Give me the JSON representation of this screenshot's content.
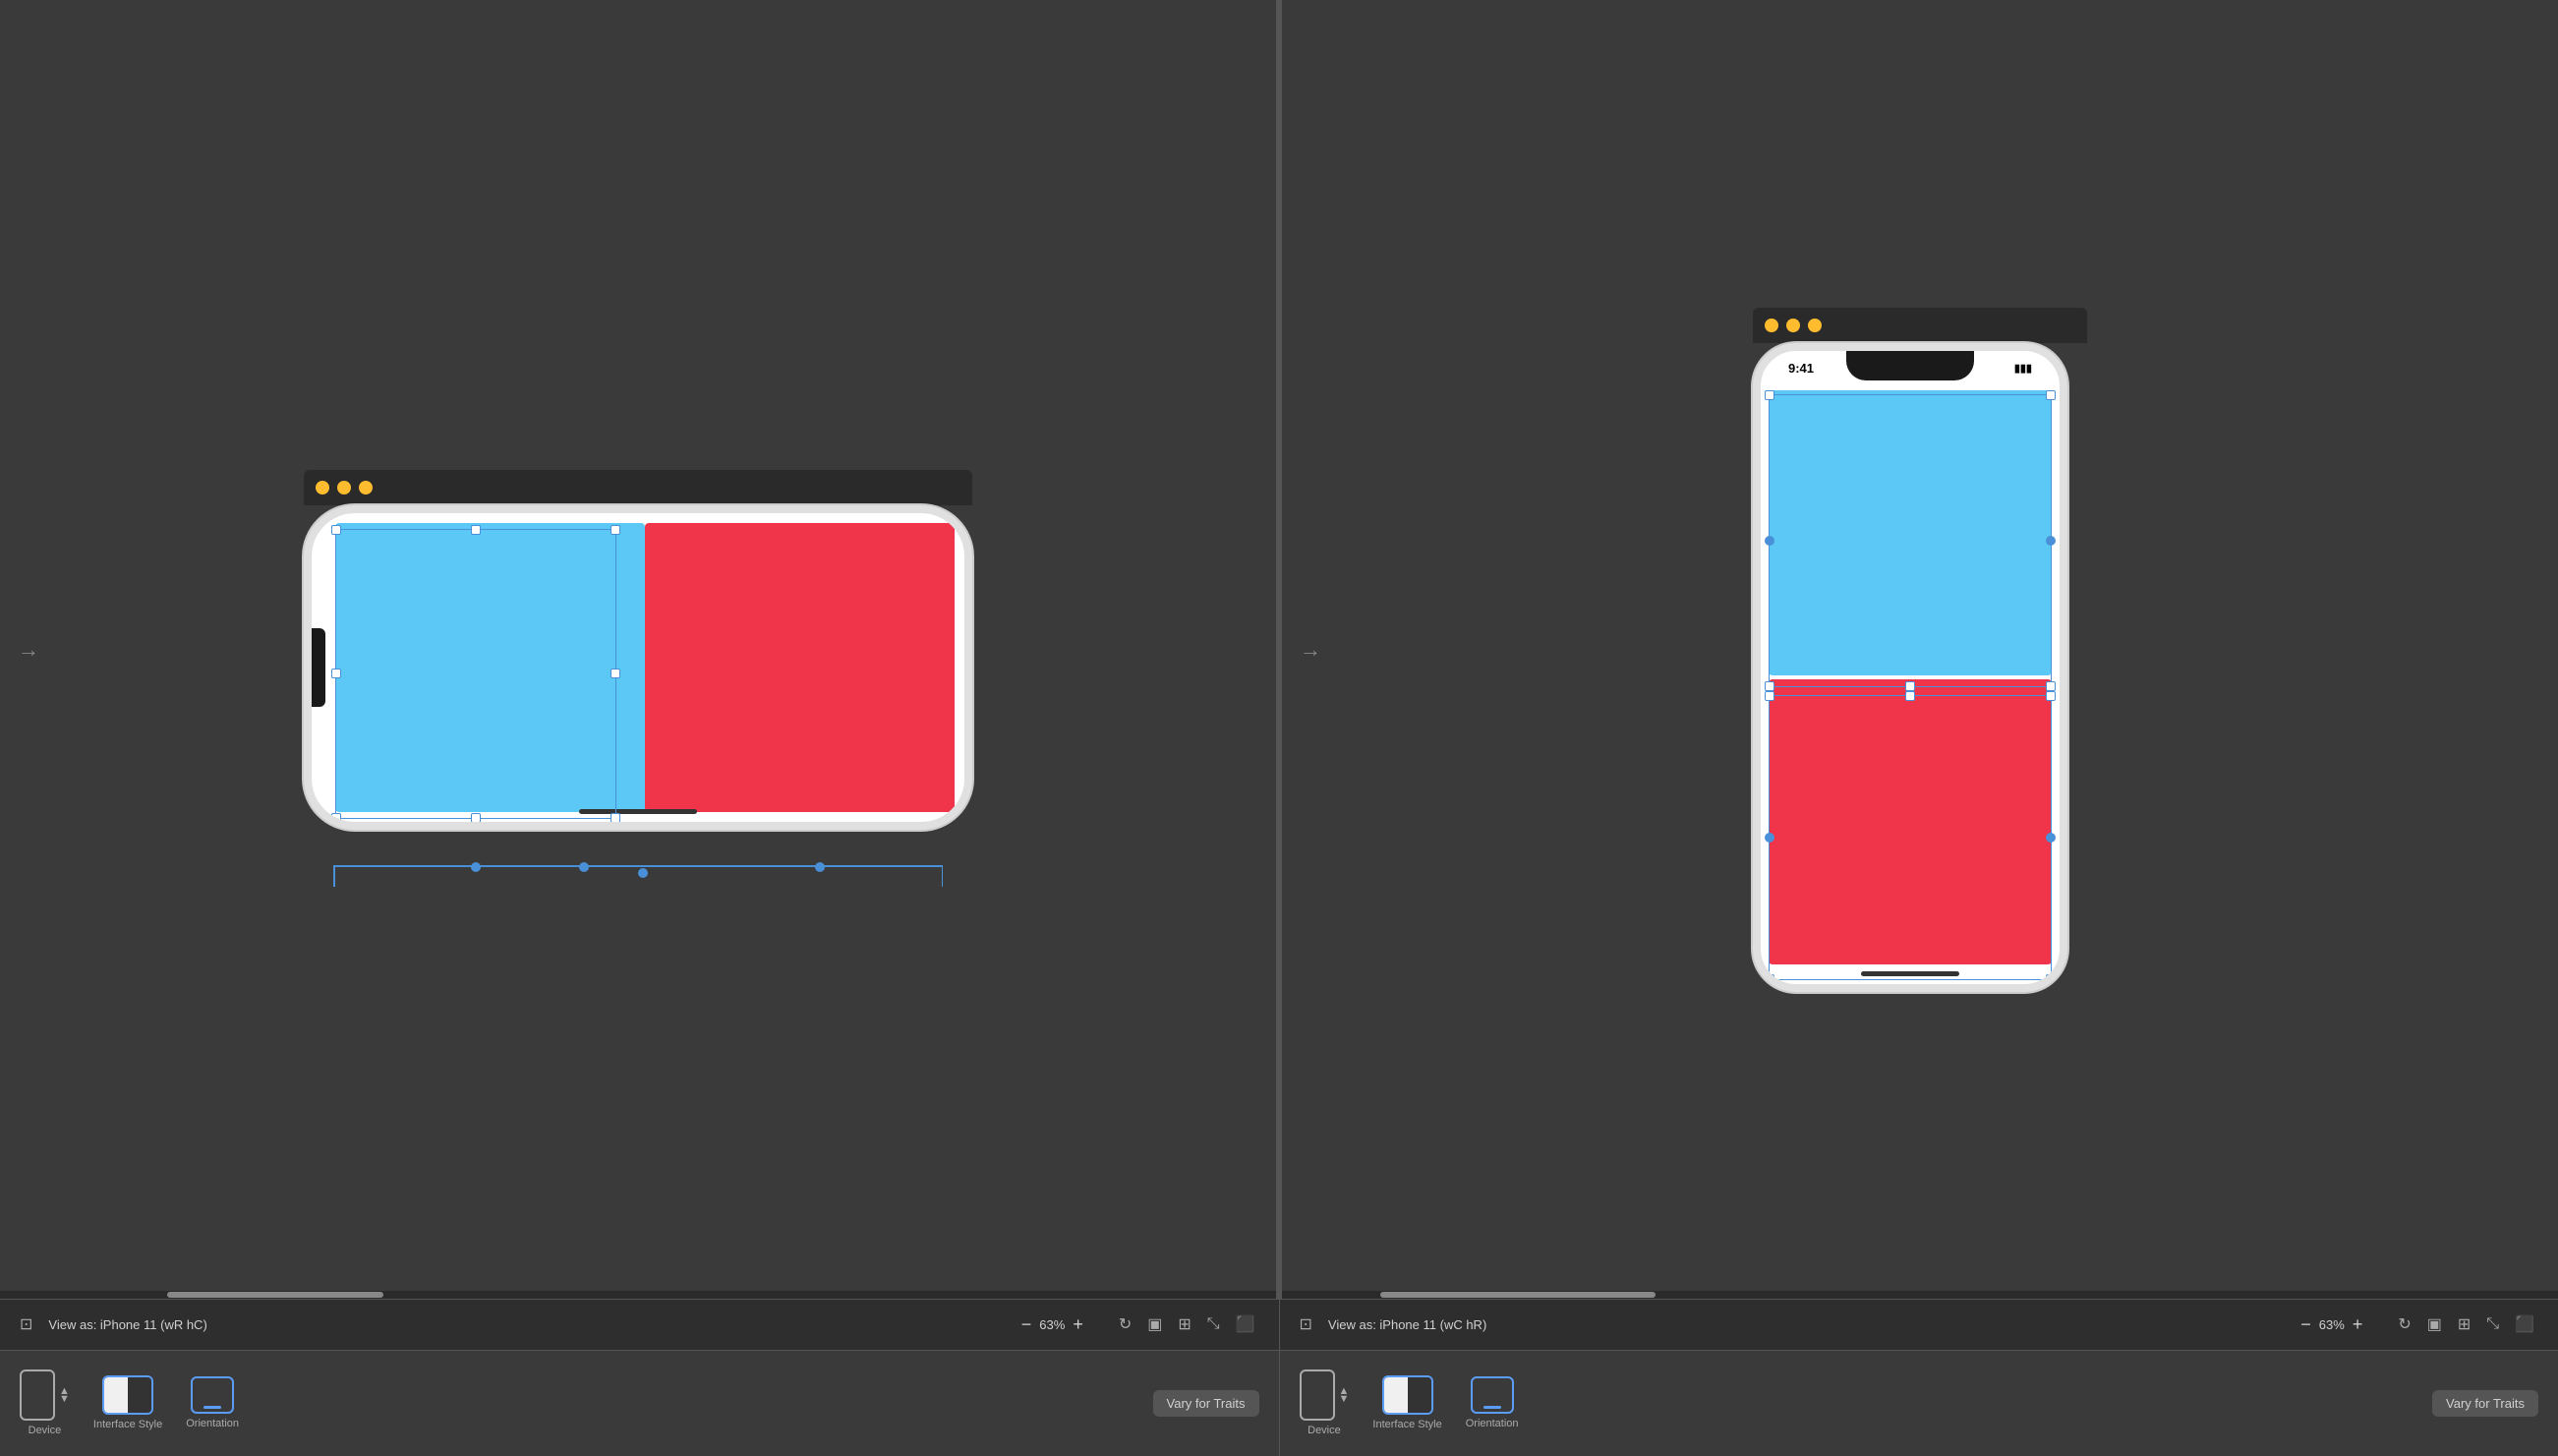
{
  "panels": [
    {
      "id": "left",
      "statusBar": {
        "viewLabel": "View as: iPhone 11 (wR hC)",
        "zoom": "63%",
        "zoomMinus": "−",
        "zoomPlus": "+"
      },
      "deviceBar": {
        "deviceLabel": "Device",
        "interfaceStyleLabel": "Interface Style",
        "orientationLabel": "Orientation",
        "varyButton": "Vary for Traits"
      },
      "window": {
        "trafficLights": [
          "red",
          "yellow",
          "green"
        ]
      }
    },
    {
      "id": "right",
      "statusBar": {
        "viewLabel": "View as: iPhone 11 (wC hR)",
        "zoom": "63%",
        "zoomMinus": "−",
        "zoomPlus": "+"
      },
      "deviceBar": {
        "deviceLabel": "Device",
        "interfaceStyleLabel": "Interface Style",
        "orientationLabel": "Orientation",
        "varyButton": "Vary for Traits"
      },
      "window": {
        "trafficLights": [
          "red",
          "yellow",
          "green"
        ]
      }
    }
  ],
  "colors": {
    "blue": "#5bc8f5",
    "red": "#f0344a",
    "background": "#3a3a3a",
    "windowBar": "#2a2a2a",
    "statusBar": "#2e2e2e",
    "selectionBlue": "#4a90d9",
    "trafficRed": "#ff5f57",
    "trafficYellow": "#febc2e",
    "trafficGreen": "#28c840"
  },
  "statusTime": "9:41",
  "scrollbar": {
    "leftThumbLeft": "170px",
    "leftThumbWidth": "220px",
    "rightThumbLeft": "100px",
    "rightThumbWidth": "280px"
  }
}
